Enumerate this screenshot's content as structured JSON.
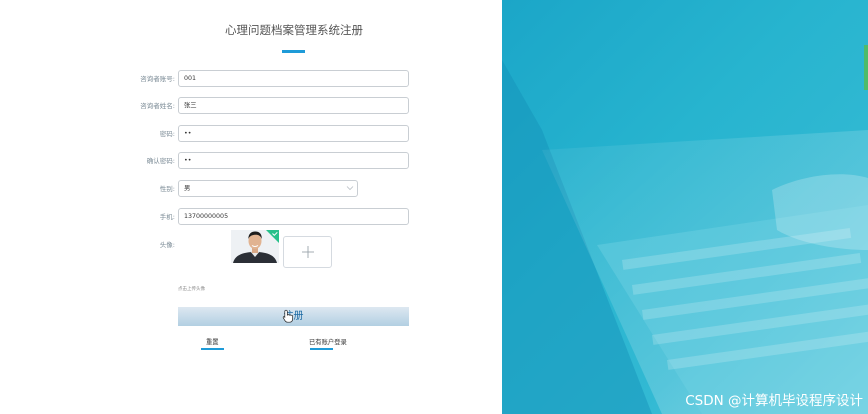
{
  "form": {
    "title": "心理问题档案管理系统注册",
    "fields": [
      {
        "label": "咨询者账号:",
        "value": "001"
      },
      {
        "label": "咨询者姓名:",
        "value": "张三"
      },
      {
        "label": "密码:",
        "value": "••"
      },
      {
        "label": "确认密码:",
        "value": "••"
      },
      {
        "label": "性别:",
        "value": "男"
      },
      {
        "label": "手机:",
        "value": "13700000005"
      }
    ],
    "avatar_label": "头像:",
    "upload_hint": "点击上传头像",
    "submit_label": "注册",
    "reset_label": "重置",
    "login_link": "已有账户登录"
  },
  "watermark": "CSDN @计算机毕设程序设计",
  "colors": {
    "accent": "#1e9bd8",
    "hero": "#27b4cf"
  }
}
